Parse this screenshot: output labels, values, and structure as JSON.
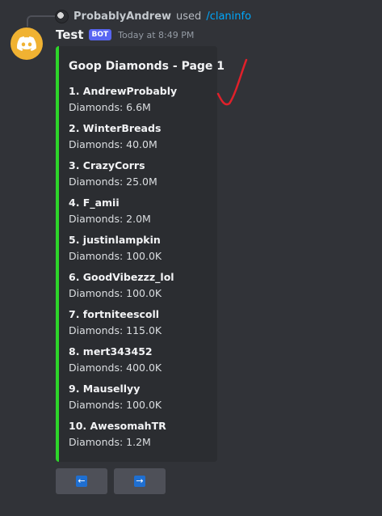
{
  "reply": {
    "username": "ProbablyAndrew",
    "used_text": "used",
    "command": "/claninfo"
  },
  "message": {
    "author": "Test",
    "badge": "BOT",
    "timestamp": "Today at 8:49 PM"
  },
  "embed": {
    "accent_color": "#2dd52a",
    "title": "Goop Diamonds - Page 1",
    "fields": [
      {
        "name": "1. AndrewProbably",
        "value": "Diamonds: 6.6M"
      },
      {
        "name": "2. WinterBreads",
        "value": "Diamonds: 40.0M"
      },
      {
        "name": "3. CrazyCorrs",
        "value": "Diamonds: 25.0M"
      },
      {
        "name": "4. F_amii",
        "value": "Diamonds: 2.0M"
      },
      {
        "name": "5. justinlampkin",
        "value": "Diamonds: 100.0K"
      },
      {
        "name": "6. GoodVibezzz_lol",
        "value": "Diamonds: 100.0K"
      },
      {
        "name": "7. fortniteescoll",
        "value": "Diamonds: 115.0K"
      },
      {
        "name": "8. mert343452",
        "value": "Diamonds: 400.0K"
      },
      {
        "name": "9. Mausellyy",
        "value": "Diamonds: 100.0K"
      },
      {
        "name": "10. AwesomahTR",
        "value": "Diamonds: 1.2M"
      }
    ]
  },
  "buttons": {
    "prev_icon": "arrow-left-icon",
    "prev_glyph": "←",
    "next_icon": "arrow-right-icon",
    "next_glyph": "→"
  },
  "colors": {
    "background": "#313338",
    "avatar_bg": "#f0b232",
    "bot_badge": "#5865f2",
    "command_link": "#00a8fc",
    "annotation": "#e0202a"
  }
}
